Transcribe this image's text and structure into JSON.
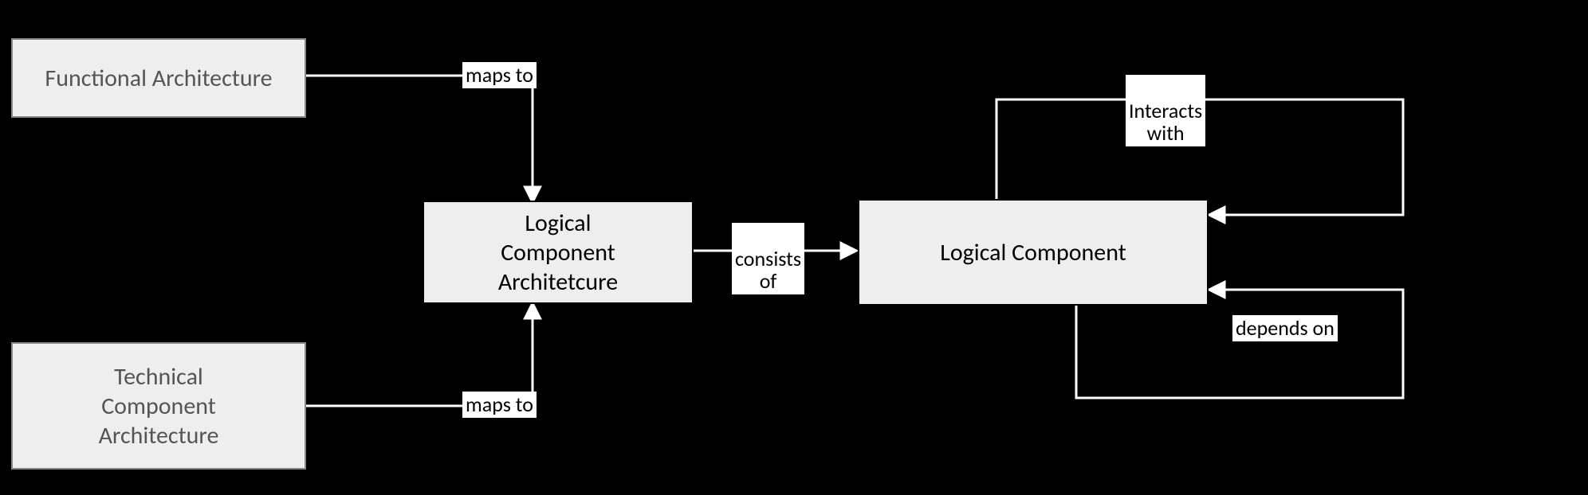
{
  "boxes": {
    "functional_architecture": "Functional Architecture",
    "technical_component_architecture": "Technical\nComponent\nArchitecture",
    "logical_component_architecture": "Logical\nComponent\nArchitetcure",
    "logical_component": "Logical Component"
  },
  "labels": {
    "maps_to_top": "maps to",
    "maps_to_bottom": "maps to",
    "consists_of": "consists\nof",
    "interacts_with": "Interacts\nwith",
    "depends_on": "depends on"
  }
}
